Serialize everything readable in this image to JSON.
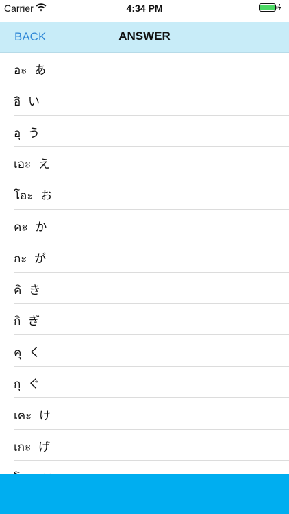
{
  "status_bar": {
    "carrier": "Carrier",
    "time": "4:34 PM",
    "wifi_icon": "wifi-icon",
    "battery_icon": "battery-icon",
    "battery_color": "#4cd964"
  },
  "nav": {
    "back_label": "BACK",
    "title": "ANSWER",
    "background": "#c8ecf8",
    "back_color": "#2e86d6"
  },
  "answers": [
    {
      "text": "อะ  あ"
    },
    {
      "text": "อิ  い"
    },
    {
      "text": "อุ  う"
    },
    {
      "text": "เอะ  え"
    },
    {
      "text": "โอะ  お"
    },
    {
      "text": "คะ  か"
    },
    {
      "text": "กะ  が"
    },
    {
      "text": "คิ  き"
    },
    {
      "text": "กิ  ぎ"
    },
    {
      "text": "คุ  く"
    },
    {
      "text": "กุ  ぐ"
    },
    {
      "text": "เคะ  け"
    },
    {
      "text": "เกะ  げ"
    },
    {
      "text": "โคะ  こ"
    }
  ],
  "bottom_bar": {
    "color": "#00aef0"
  }
}
